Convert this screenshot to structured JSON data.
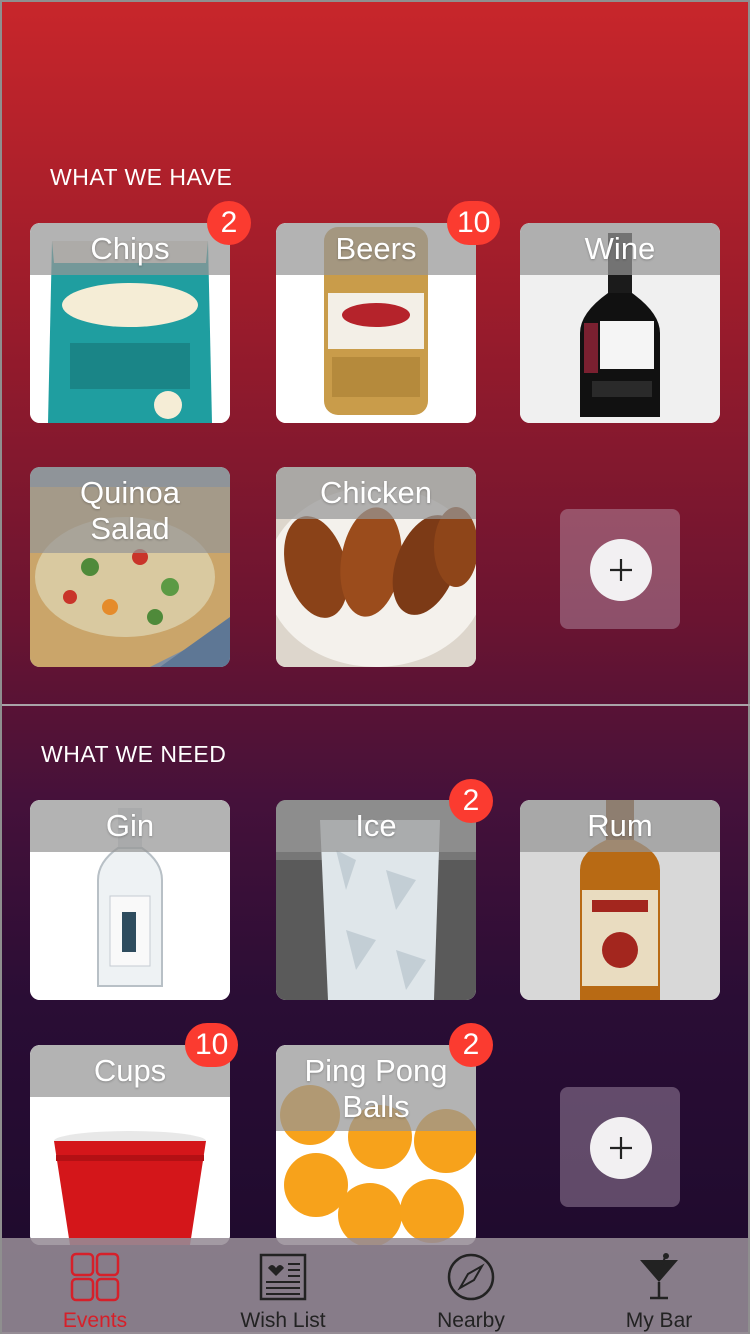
{
  "have": {
    "title": "WHAT WE HAVE",
    "items": [
      {
        "label": "Chips",
        "badge": "2"
      },
      {
        "label": "Beers",
        "badge": "10"
      },
      {
        "label": "Wine",
        "badge": ""
      },
      {
        "label": "Quinoa Salad",
        "badge": ""
      },
      {
        "label": "Chicken",
        "badge": ""
      }
    ],
    "add_icon": "plus-icon"
  },
  "need": {
    "title": "WHAT WE NEED",
    "items": [
      {
        "label": "Gin",
        "badge": ""
      },
      {
        "label": "Ice",
        "badge": "2"
      },
      {
        "label": "Rum",
        "badge": ""
      },
      {
        "label": "Cups",
        "badge": "10"
      },
      {
        "label": "Ping Pong Balls",
        "badge": "2"
      }
    ],
    "add_icon": "plus-icon"
  },
  "tabbar": {
    "tabs": [
      {
        "label": "Events",
        "icon": "grid-icon",
        "active": true
      },
      {
        "label": "Wish List",
        "icon": "list-icon",
        "active": false
      },
      {
        "label": "Nearby",
        "icon": "compass-icon",
        "active": false
      },
      {
        "label": "My Bar",
        "icon": "cocktail-icon",
        "active": false
      }
    ]
  },
  "colors": {
    "accent": "#d6202a",
    "badge": "#fb3b30"
  }
}
